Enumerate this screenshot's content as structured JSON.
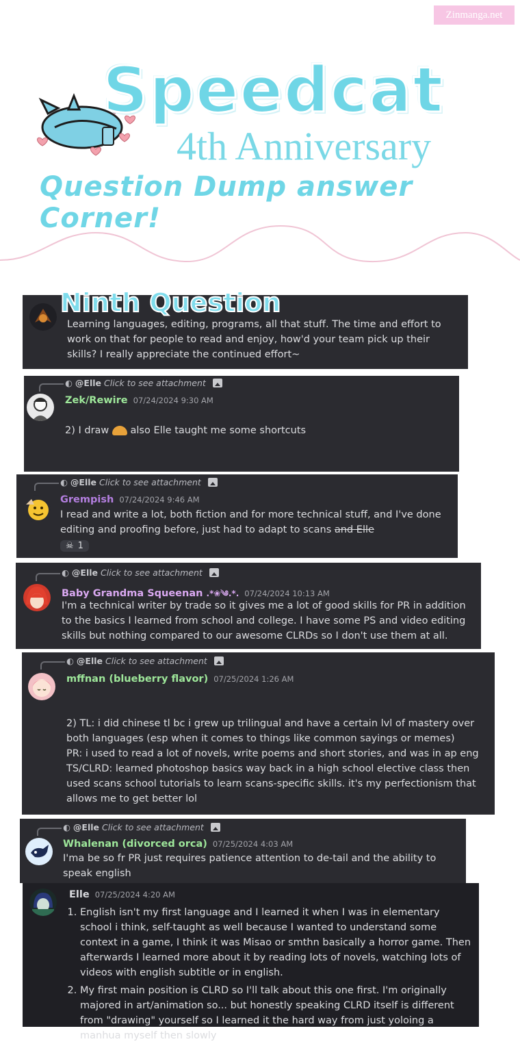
{
  "watermark": "Zinmanga.net",
  "header": {
    "title": "Speedcat",
    "subtitle": "4th Anniversary",
    "tagline": "Question Dump answer Corner!"
  },
  "question": {
    "heading": "Ninth Question",
    "text": "Learning languages, editing, programs, all that stuff. The time and effort to work on that for people to read and enjoy, how'd your team pick up their skills? I really appreciate the continued effort~"
  },
  "reply_common": {
    "mention": "@Elle",
    "attachment_text": "Click to see attachment"
  },
  "messages": [
    {
      "user": "Zek/Rewire",
      "timestamp": "07/24/2024 9:30 AM",
      "text_before": "2) I draw",
      "text_after": "also Elle taught me some shortcuts",
      "color": "#9ee79a"
    },
    {
      "user": "Grempish",
      "timestamp": "07/24/2024 9:46 AM",
      "text": "I read and write a lot, both fiction and for more technical stuff, and I've done editing and proofing before, just had to adapt to scans",
      "strike": "and Elle",
      "reaction_count": "1",
      "color": "#b47fe0"
    },
    {
      "user": "Baby Grandma Squeenan",
      "user_deco": ".*❀༄.*.",
      "timestamp": "07/24/2024 10:13 AM",
      "text": "I'm a technical writer by trade so it gives me a lot of good skills for PR in addition to the basics I learned from school and college. I have some PS and video editing skills but nothing compared to our awesome CLRDs so I don't use them at all.",
      "color": "#d9a8f0"
    },
    {
      "user": "mffnan (blueberry flavor)",
      "timestamp": "07/25/2024 1:26 AM",
      "lines": [
        "2) TL: i did chinese tl bc i grew up trilingual and have a certain lvl of mastery over both languages (esp when it comes to things like common sayings or memes)",
        "PR: i used to read a lot of novels, write poems and short stories, and was in ap eng",
        "TS/CLRD: learned photoshop basics way back in a high school elective class then used scans school tutorials to learn scans-specific skills. it's my perfectionism that allows me to get better lol"
      ],
      "color": "#9ee79a"
    },
    {
      "user": "Whalenan (divorced orca)",
      "timestamp": "07/25/2024 4:03 AM",
      "text": "I'ma be so fr PR just requires patience attention to de-tail and the ability to speak english",
      "color": "#9ee79a"
    },
    {
      "user": "Elle",
      "timestamp": "07/25/2024 4:20 AM",
      "items": [
        "English isn't my first language and I learned it when I was in elementary school i think, self-taught as well because I wanted to understand some context in a game, I think it was Misao or smthn basically a horror game. Then afterwards I learned more about it by reading lots of novels, watching lots of videos with english subtitle or in english.",
        "My first main position is CLRD so I'll talk about this one first.  I'm originally majored in art/animation so... but honestly speaking CLRD itself is different from \"drawing\" yourself so I learned it the hard way from just yoloing a manhua myself then slowly"
      ],
      "color": "#d8d9dd"
    }
  ],
  "colors": {
    "panel": "#2b2b30",
    "panel_dark": "#1f1f24",
    "accent_cyan": "#6fd6e6"
  }
}
